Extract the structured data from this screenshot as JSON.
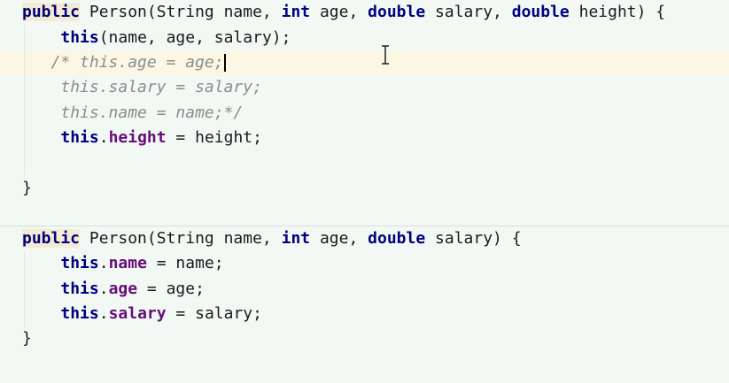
{
  "editor": {
    "current_line": 2,
    "caret_line": 2,
    "lines": [
      {
        "tokens": [
          {
            "t": "public",
            "c": "kw pub"
          },
          {
            "t": " Person(String name, "
          },
          {
            "t": "int",
            "c": "kw"
          },
          {
            "t": " age, "
          },
          {
            "t": "double",
            "c": "kw"
          },
          {
            "t": " salary, "
          },
          {
            "t": "double",
            "c": "kw"
          },
          {
            "t": " height) {"
          }
        ]
      },
      {
        "tokens": [
          {
            "t": "    "
          },
          {
            "t": "this",
            "c": "kw"
          },
          {
            "t": "(name, age, salary);"
          }
        ]
      },
      {
        "tokens": [
          {
            "t": "   "
          },
          {
            "t": "/* this.age = age;",
            "c": "cm"
          }
        ]
      },
      {
        "tokens": [
          {
            "t": "    "
          },
          {
            "t": "this.salary = salary;",
            "c": "cm"
          }
        ]
      },
      {
        "tokens": [
          {
            "t": "    "
          },
          {
            "t": "this.name = name;*/",
            "c": "cm"
          }
        ]
      },
      {
        "tokens": [
          {
            "t": "    "
          },
          {
            "t": "this",
            "c": "kw"
          },
          {
            "t": "."
          },
          {
            "t": "height",
            "c": "field"
          },
          {
            "t": " = height;"
          }
        ]
      },
      {
        "tokens": [
          {
            "t": ""
          }
        ]
      },
      {
        "tokens": [
          {
            "t": "}"
          }
        ]
      },
      {
        "tokens": [
          {
            "t": "public",
            "c": "kw pub"
          },
          {
            "t": " Person(String name, "
          },
          {
            "t": "int",
            "c": "kw"
          },
          {
            "t": " age, "
          },
          {
            "t": "double",
            "c": "kw"
          },
          {
            "t": " salary) {"
          }
        ]
      },
      {
        "tokens": [
          {
            "t": "    "
          },
          {
            "t": "this",
            "c": "kw"
          },
          {
            "t": "."
          },
          {
            "t": "name",
            "c": "field"
          },
          {
            "t": " = name;"
          }
        ]
      },
      {
        "tokens": [
          {
            "t": "    "
          },
          {
            "t": "this",
            "c": "kw"
          },
          {
            "t": "."
          },
          {
            "t": "age",
            "c": "field"
          },
          {
            "t": " = age;"
          }
        ]
      },
      {
        "tokens": [
          {
            "t": "    "
          },
          {
            "t": "this",
            "c": "kw"
          },
          {
            "t": "."
          },
          {
            "t": "salary",
            "c": "field"
          },
          {
            "t": " = salary;"
          }
        ]
      },
      {
        "tokens": [
          {
            "t": "}"
          }
        ]
      }
    ]
  }
}
